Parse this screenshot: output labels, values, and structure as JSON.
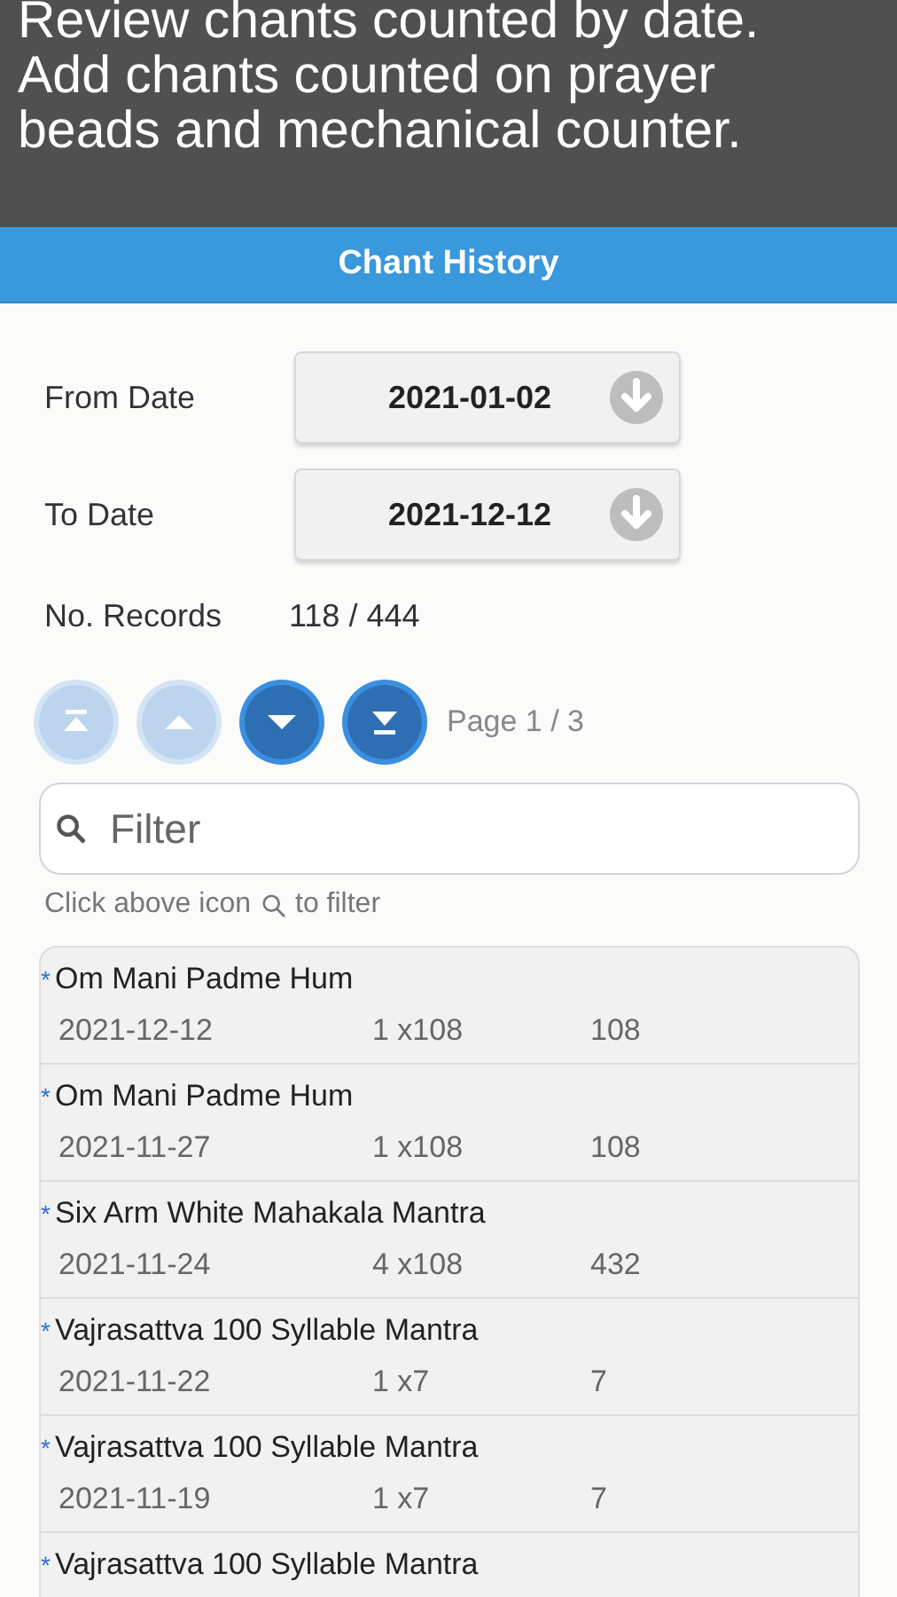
{
  "banner": {
    "lines": [
      "Review chants counted by date.",
      "Add chants counted on prayer",
      "beads and mechanical counter."
    ]
  },
  "title_bar": {
    "title": "Chant History"
  },
  "date_fields": [
    {
      "label": "From Date",
      "value": "2021-01-02"
    },
    {
      "label": "To Date",
      "value": "2021-12-12"
    }
  ],
  "records": {
    "label": "No. Records",
    "value": "118 / 444"
  },
  "pager": {
    "buttons": [
      {
        "kind": "first",
        "disabled": true
      },
      {
        "kind": "prev",
        "disabled": true
      },
      {
        "kind": "next",
        "disabled": false
      },
      {
        "kind": "last",
        "disabled": false
      }
    ],
    "page": "Page 1 / 3"
  },
  "filter": {
    "placeholder": "Filter",
    "hint_before": "Click above icon",
    "hint_after": "to filter"
  },
  "entries": [
    {
      "marker": "*",
      "title": "Om Mani Padme Hum",
      "date": "2021-12-12",
      "count": "1 x108",
      "total": "108"
    },
    {
      "marker": "*",
      "title": "Om Mani Padme Hum",
      "date": "2021-11-27",
      "count": "1 x108",
      "total": "108"
    },
    {
      "marker": "*",
      "title": "Six Arm White Mahakala Mantra",
      "date": "2021-11-24",
      "count": "4 x108",
      "total": "432"
    },
    {
      "marker": "*",
      "title": "Vajrasattva 100 Syllable Mantra",
      "date": "2021-11-22",
      "count": "1 x7",
      "total": "7"
    },
    {
      "marker": "*",
      "title": "Vajrasattva 100 Syllable Mantra",
      "date": "2021-11-19",
      "count": "1 x7",
      "total": "7"
    },
    {
      "marker": "*",
      "title": "Vajrasattva 100 Syllable Mantra"
    }
  ]
}
